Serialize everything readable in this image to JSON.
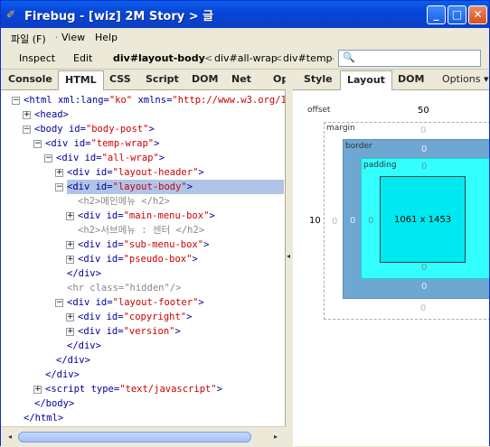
{
  "window": {
    "title": "Firebug - [wiz] 2M Story > 글",
    "minimize": "_",
    "maximize": "□",
    "close": "✕"
  },
  "menu": {
    "file": "파일 (F)",
    "view": "View",
    "help": "Help"
  },
  "toolbar": {
    "inspect": "Inspect",
    "edit": "Edit",
    "crumb_current": "div#layout-body",
    "crumb1": "div#all-wrap",
    "crumb2": "div#temp-w",
    "sep": "<"
  },
  "search": {
    "placeholder": ""
  },
  "left_tabs": [
    "Console",
    "HTML",
    "CSS",
    "Script",
    "DOM",
    "Net",
    "Op"
  ],
  "right_tabs": [
    "Style",
    "Layout",
    "DOM"
  ],
  "options_label": "Options ▾",
  "html_tree": [
    {
      "indent": 0,
      "toggle": "−",
      "parts": [
        [
          "tag",
          "<html "
        ],
        [
          "attr",
          "xml:lang="
        ],
        [
          "val",
          "\"ko\""
        ],
        [
          "attr",
          " xmlns="
        ],
        [
          "val",
          "\"http://www.w3.org/199"
        ]
      ]
    },
    {
      "indent": 1,
      "toggle": "+",
      "parts": [
        [
          "tag",
          "<head>"
        ]
      ]
    },
    {
      "indent": 1,
      "toggle": "−",
      "parts": [
        [
          "tag",
          "<body "
        ],
        [
          "attr",
          "id="
        ],
        [
          "val",
          "\"body-post\""
        ],
        [
          "tag",
          ">"
        ]
      ]
    },
    {
      "indent": 2,
      "toggle": "−",
      "parts": [
        [
          "tag",
          "<div "
        ],
        [
          "attr",
          "id="
        ],
        [
          "val",
          "\"temp-wrap\""
        ],
        [
          "tag",
          ">"
        ]
      ]
    },
    {
      "indent": 3,
      "toggle": "−",
      "parts": [
        [
          "tag",
          "<div "
        ],
        [
          "attr",
          "id="
        ],
        [
          "val",
          "\"all-wrap\""
        ],
        [
          "tag",
          ">"
        ]
      ]
    },
    {
      "indent": 4,
      "toggle": "+",
      "parts": [
        [
          "tag",
          "<div "
        ],
        [
          "attr",
          "id="
        ],
        [
          "val",
          "\"layout-header\""
        ],
        [
          "tag",
          ">"
        ]
      ]
    },
    {
      "indent": 4,
      "toggle": "−",
      "hl": true,
      "parts": [
        [
          "tag",
          "<div "
        ],
        [
          "attr",
          "id="
        ],
        [
          "val",
          "\"layout-body\""
        ],
        [
          "tag",
          ">"
        ]
      ]
    },
    {
      "indent": 5,
      "toggle": "",
      "parts": [
        [
          "gray",
          "<h2>메인메뉴 </h2>"
        ]
      ]
    },
    {
      "indent": 5,
      "toggle": "+",
      "parts": [
        [
          "tag",
          "<div "
        ],
        [
          "attr",
          "id="
        ],
        [
          "val",
          "\"main-menu-box\""
        ],
        [
          "tag",
          ">"
        ]
      ]
    },
    {
      "indent": 5,
      "toggle": "",
      "parts": [
        [
          "gray",
          "<h2>서브메뉴 : 센터 </h2>"
        ]
      ]
    },
    {
      "indent": 5,
      "toggle": "+",
      "parts": [
        [
          "tag",
          "<div "
        ],
        [
          "attr",
          "id="
        ],
        [
          "val",
          "\"sub-menu-box\""
        ],
        [
          "tag",
          ">"
        ]
      ]
    },
    {
      "indent": 5,
      "toggle": "+",
      "parts": [
        [
          "tag",
          "<div "
        ],
        [
          "attr",
          "id="
        ],
        [
          "val",
          "\"pseudo-box\""
        ],
        [
          "tag",
          ">"
        ]
      ]
    },
    {
      "indent": 4,
      "toggle": "",
      "parts": [
        [
          "tag",
          "</div>"
        ]
      ]
    },
    {
      "indent": 4,
      "toggle": "",
      "parts": [
        [
          "gray",
          "<hr class=\"hidden\"/>"
        ]
      ]
    },
    {
      "indent": 4,
      "toggle": "−",
      "parts": [
        [
          "tag",
          "<div "
        ],
        [
          "attr",
          "id="
        ],
        [
          "val",
          "\"layout-footer\""
        ],
        [
          "tag",
          ">"
        ]
      ]
    },
    {
      "indent": 5,
      "toggle": "+",
      "parts": [
        [
          "tag",
          "<div "
        ],
        [
          "attr",
          "id="
        ],
        [
          "val",
          "\"copyright\""
        ],
        [
          "tag",
          ">"
        ]
      ]
    },
    {
      "indent": 5,
      "toggle": "+",
      "parts": [
        [
          "tag",
          "<div "
        ],
        [
          "attr",
          "id="
        ],
        [
          "val",
          "\"version\""
        ],
        [
          "tag",
          ">"
        ]
      ]
    },
    {
      "indent": 4,
      "toggle": "",
      "parts": [
        [
          "tag",
          "</div>"
        ]
      ]
    },
    {
      "indent": 3,
      "toggle": "",
      "parts": [
        [
          "tag",
          "</div>"
        ]
      ]
    },
    {
      "indent": 2,
      "toggle": "",
      "parts": [
        [
          "tag",
          "</div>"
        ]
      ]
    },
    {
      "indent": 2,
      "toggle": "+",
      "parts": [
        [
          "tag",
          "<script "
        ],
        [
          "attr",
          "type="
        ],
        [
          "val",
          "\"text/javascript\""
        ],
        [
          "tag",
          ">"
        ]
      ]
    },
    {
      "indent": 1,
      "toggle": "",
      "parts": [
        [
          "tag",
          "</body>"
        ]
      ]
    },
    {
      "indent": 0,
      "toggle": "",
      "parts": [
        [
          "tag",
          "</html>"
        ]
      ]
    }
  ],
  "layout": {
    "offset_label": "offset",
    "offset_top": "50",
    "offset_left": "10",
    "margin_label": "margin",
    "margin_top": "0",
    "margin_left": "0",
    "margin_bottom": "0",
    "border_label": "border",
    "border_top": "0",
    "border_left": "0",
    "border_bottom": "0",
    "padding_label": "padding",
    "padding_top": "0",
    "padding_left": "0",
    "padding_bottom": "0",
    "content_size": "1061 x 1453",
    "colors": {
      "margin": "#ffffff",
      "border": "#6fa7d3",
      "padding": "#33ffff",
      "content": "#00e8f0"
    }
  }
}
